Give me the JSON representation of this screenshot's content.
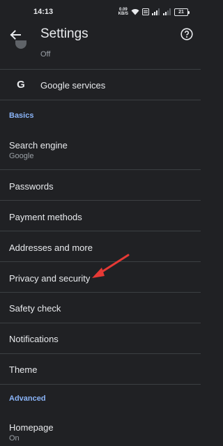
{
  "status_bar": {
    "time": "14:13",
    "net_speed_value": "0.09",
    "net_speed_unit": "KB/S",
    "battery": "21"
  },
  "app_bar": {
    "title": "Settings"
  },
  "list": {
    "partial_item_subtitle": "Off",
    "google_services": "Google services",
    "basics_header": "Basics",
    "search_engine": {
      "title": "Search engine",
      "subtitle": "Google"
    },
    "passwords": "Passwords",
    "payment_methods": "Payment methods",
    "addresses": "Addresses and more",
    "privacy": "Privacy and security",
    "safety_check": "Safety check",
    "notifications": "Notifications",
    "theme": "Theme",
    "advanced_header": "Advanced",
    "homepage": {
      "title": "Homepage",
      "subtitle": "On"
    }
  },
  "annotation": {
    "arrow_color": "#e53935"
  },
  "colors": {
    "background": "#202124",
    "text": "#e8eaed",
    "secondary_text": "#9aa0a6",
    "accent": "#8ab4f8",
    "divider": "#3c4043"
  }
}
